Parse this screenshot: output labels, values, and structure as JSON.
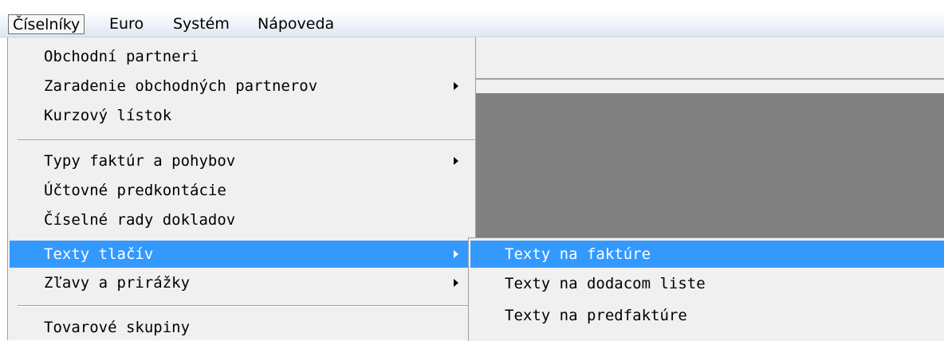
{
  "menubar": {
    "items": [
      {
        "label": "Číselníky"
      },
      {
        "label": "Euro"
      },
      {
        "label": "Systém"
      },
      {
        "label": "Nápoveda"
      }
    ]
  },
  "menu": {
    "items": [
      {
        "label": "Obchodní partneri"
      },
      {
        "label": "Zaradenie obchodných partnerov"
      },
      {
        "label": "Kurzový lístok"
      },
      {
        "label": "Typy faktúr a pohybov"
      },
      {
        "label": "Účtovné predkontácie"
      },
      {
        "label": "Číselné rady dokladov"
      },
      {
        "label": "Texty tlačív"
      },
      {
        "label": "Zľavy a prirážky"
      },
      {
        "label": "Tovarové skupiny"
      }
    ]
  },
  "submenu": {
    "items": [
      {
        "label": "Texty na faktúre"
      },
      {
        "label": "Texty na dodacom liste"
      },
      {
        "label": "Texty na predfaktúre"
      }
    ]
  },
  "colors": {
    "highlight": "#3399ff",
    "menu_background": "#f0f0f0",
    "workspace": "#808080"
  },
  "icons": {
    "submenu_arrow": "chevron-right-icon"
  }
}
